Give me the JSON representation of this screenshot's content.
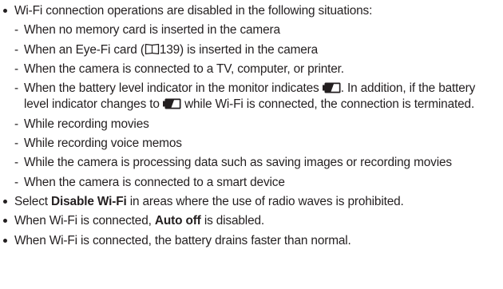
{
  "notes": {
    "wifi_disabled_intro": "Wi-Fi connection operations are disabled in the following situations:",
    "dash": "-",
    "situations": {
      "no_card": "When no memory card is inserted in the camera",
      "eyefi_before": "When an Eye-Fi card (",
      "eyefi_page": "139",
      "eyefi_after": ") is inserted in the camera",
      "connected": "When the camera is connected to a TV, computer, or printer.",
      "battery_a": "When the battery level indicator in the monitor indicates",
      "battery_b": ". In addition, if the battery level indicator changes to",
      "battery_c": "while Wi-Fi is connected, the connection is terminated.",
      "recording_movies": "While recording movies",
      "voice_memos": "While recording voice memos",
      "processing": "While the camera is processing data such as saving images or recording movies",
      "smart_device": "When the camera is connected to a smart device"
    },
    "disable_wifi_a": "Select",
    "disable_wifi_bold": "Disable Wi-Fi",
    "disable_wifi_b": "in areas where the use of radio waves is prohibited.",
    "auto_off_a": "When Wi-Fi is connected,",
    "auto_off_bold": "Auto off",
    "auto_off_b": "is disabled.",
    "battery_drain": "When Wi-Fi is connected, the battery drains faster than normal."
  },
  "icons": {
    "book": "book-reference-icon",
    "battery": "battery-low-icon"
  },
  "colors": {
    "text": "#231f20"
  }
}
